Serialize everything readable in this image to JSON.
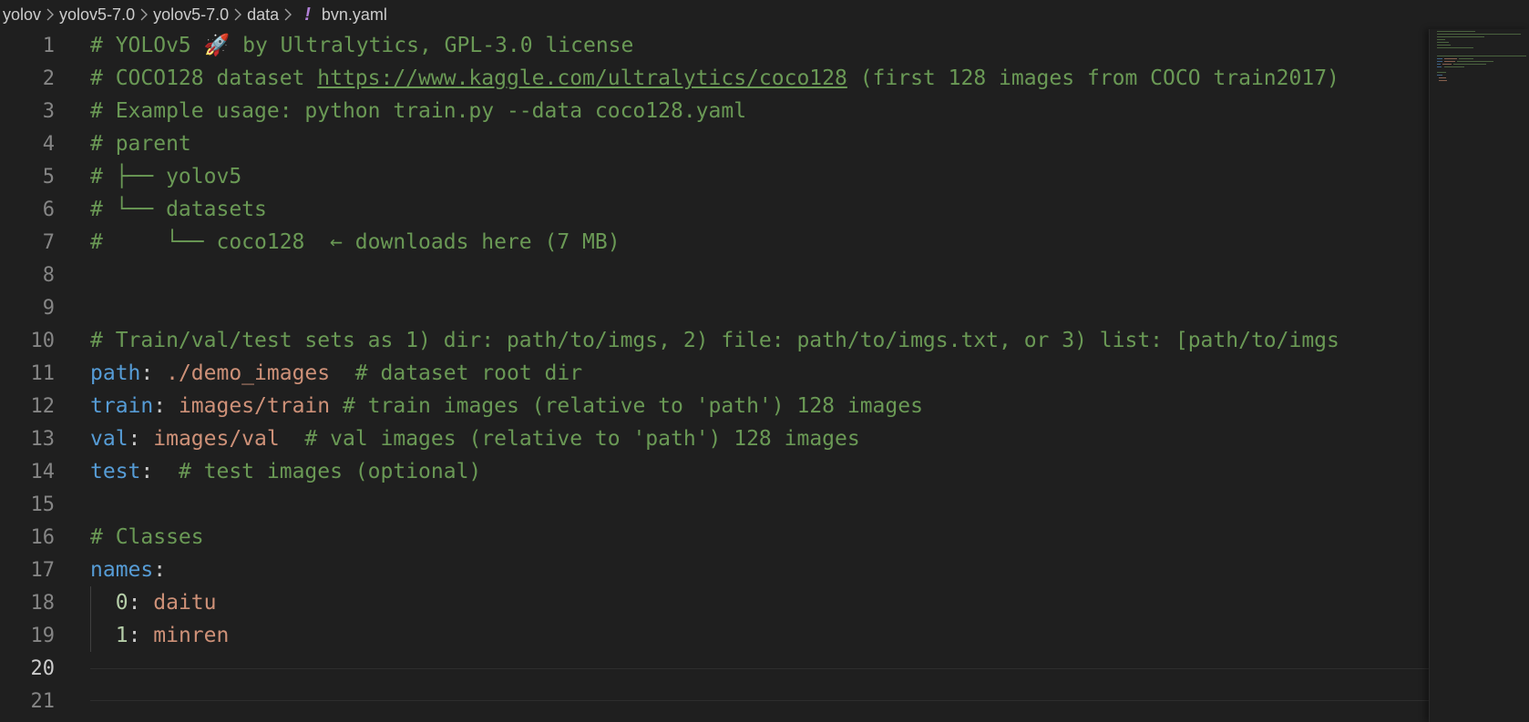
{
  "breadcrumb": {
    "items": [
      "yolov",
      "yolov5-7.0",
      "yolov5-7.0",
      "data"
    ],
    "file_icon": "!",
    "file_name": "bvn.yaml"
  },
  "editor": {
    "active_line": 20,
    "line_numbers": [
      "1",
      "2",
      "3",
      "4",
      "5",
      "6",
      "7",
      "8",
      "9",
      "10",
      "11",
      "12",
      "13",
      "14",
      "15",
      "16",
      "17",
      "18",
      "19",
      "20",
      "21"
    ],
    "code": {
      "l1": "# YOLOv5 🚀 by Ultralytics, GPL-3.0 license",
      "l2_prefix": "# COCO128 dataset ",
      "l2_link": "https://www.kaggle.com/ultralytics/coco128",
      "l2_suffix": " (first 128 images from COCO train2017)",
      "l3": "# Example usage: python train.py --data coco128.yaml",
      "l4": "# parent",
      "l5": "# ├── yolov5",
      "l6": "# └── datasets",
      "l7": "#     └── coco128  ← downloads here (7 MB)",
      "l10": "# Train/val/test sets as 1) dir: path/to/imgs, 2) file: path/to/imgs.txt, or 3) list: [path/to/imgs",
      "l11_key": "path",
      "l11_val": "./demo_images",
      "l11_comment": "  # dataset root dir",
      "l12_key": "train",
      "l12_val": "images/train",
      "l12_comment": " # train images (relative to 'path') 128 images",
      "l13_key": "val",
      "l13_val": "images/val",
      "l13_comment": "  # val images (relative to 'path') 128 images",
      "l14_key": "test",
      "l14_comment": "  # test images (optional)",
      "l16": "# Classes",
      "l17_key": "names",
      "l18_key": "0",
      "l18_val": "daitu",
      "l19_key": "1",
      "l19_val": "minren"
    }
  },
  "colors": {
    "background": "#1f1f1f",
    "comment": "#6a9955",
    "key": "#569cd6",
    "string": "#ce9178",
    "number": "#b5cea8",
    "yaml_icon": "#b180d7"
  },
  "icons": [
    "chevron-right-icon",
    "yaml-file-icon"
  ]
}
